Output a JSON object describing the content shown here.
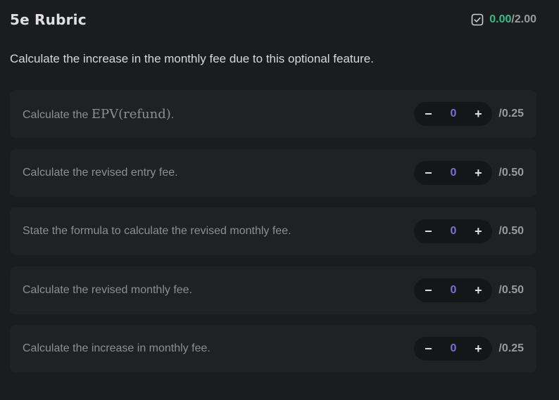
{
  "header": {
    "title": "5e Rubric",
    "score_earned": "0.00",
    "score_total": "/2.00"
  },
  "question": "Calculate the increase in the monthly fee due to this optional feature.",
  "items": [
    {
      "prefix": "Calculate the ",
      "math": "EPV(refund)",
      "suffix": ".",
      "value": "0",
      "max": "/0.25"
    },
    {
      "prefix": "Calculate the revised entry fee.",
      "math": "",
      "suffix": "",
      "value": "0",
      "max": "/0.50"
    },
    {
      "prefix": "State the formula to calculate the revised monthly fee.",
      "math": "",
      "suffix": "",
      "value": "0",
      "max": "/0.50"
    },
    {
      "prefix": "Calculate the revised monthly fee.",
      "math": "",
      "suffix": "",
      "value": "0",
      "max": "/0.50"
    },
    {
      "prefix": "Calculate the increase in monthly fee.",
      "math": "",
      "suffix": "",
      "value": "0",
      "max": "/0.25"
    }
  ],
  "icons": {
    "score": "checkbox-check-icon",
    "decrement": "minus-icon",
    "increment": "plus-icon"
  },
  "colors": {
    "background": "#1b1c1e",
    "card": "#202123",
    "earned": "#2fbf8a",
    "stepper_value": "#7b6fd1"
  },
  "stepper_symbols": {
    "decrement": "−",
    "increment": "+"
  }
}
